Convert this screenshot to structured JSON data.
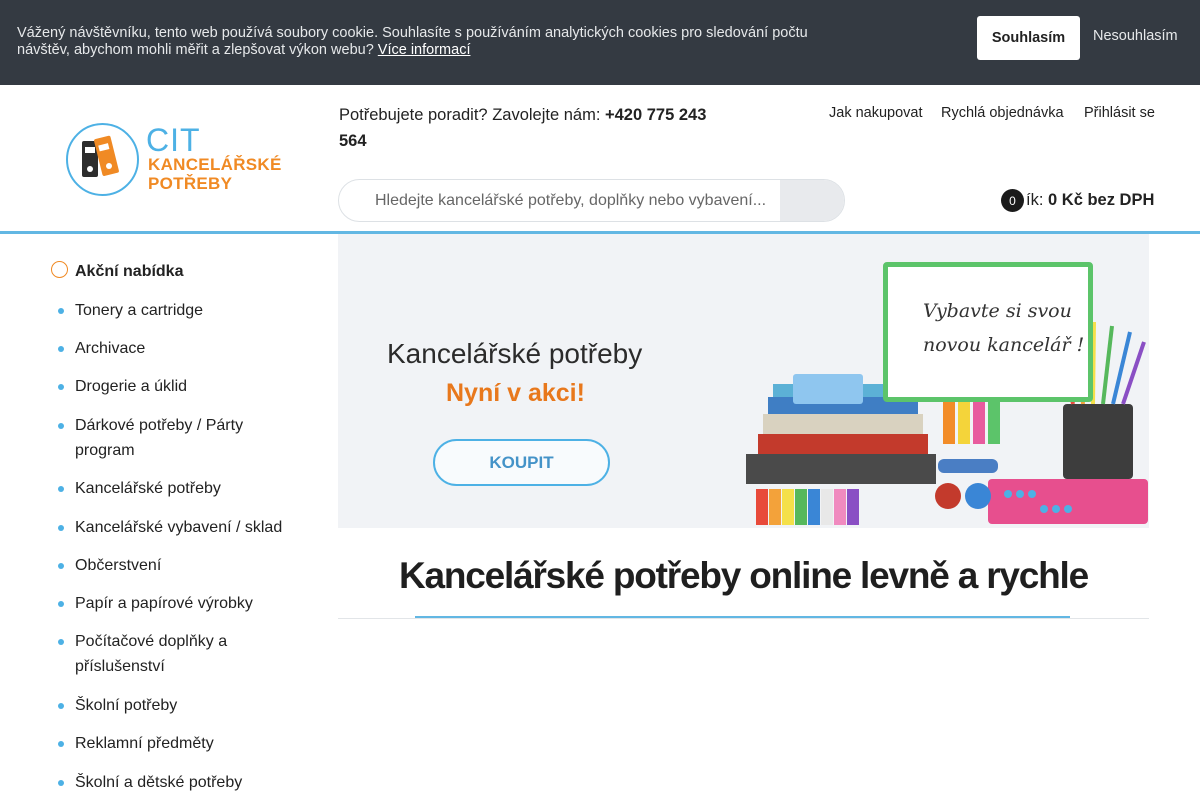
{
  "cookie": {
    "text": "Vážený návštěvníku, tento web používá soubory cookie. Souhlasíte s používáním analytických cookies pro sledování počtu návštěv, abychom mohli měřit a zlepšovat výkon webu?",
    "more_link": "Více informací",
    "accept_label": "Souhlasím",
    "decline_label": "Nesouhlasím"
  },
  "header": {
    "logo": {
      "line1": "CIT",
      "line2": "KANCELÁŘSKÉ",
      "line3": "POTŘEBY"
    },
    "advice_text": "Potřebujete poradit? Zavolejte nám:",
    "phone": "+420 775 243 564",
    "nav": [
      "Jak nakupovat",
      "Rychlá objednávka",
      "Přihlásit se"
    ],
    "search": {
      "placeholder": "Hledejte kancelářské potřeby, doplňky nebo vybavení..."
    },
    "cart": {
      "count": "0",
      "label": "ík:",
      "value": "0 Kč bez DPH"
    }
  },
  "sidebar": {
    "items": [
      {
        "label": "Akční nabídka",
        "active": true
      },
      {
        "label": "Tonery a cartridge"
      },
      {
        "label": "Archivace"
      },
      {
        "label": "Drogerie a úklid"
      },
      {
        "label": "Dárkové potřeby / Párty program"
      },
      {
        "label": "Kancelářské potřeby"
      },
      {
        "label": "Kancelářské vybavení / sklad"
      },
      {
        "label": "Občerstvení"
      },
      {
        "label": "Papír a papírové výrobky"
      },
      {
        "label": "Počítačové doplňky a příslušenství"
      },
      {
        "label": "Školní potřeby"
      },
      {
        "label": "Reklamní předměty"
      },
      {
        "label": "Školní a dětské potřeby"
      }
    ]
  },
  "banner": {
    "title": "Kancelářské potřeby",
    "subtitle": "Nyní v akci!",
    "button_label": "KOUPIT",
    "board_line1": "Vybavte si svou",
    "board_line2": "novou kancelář !"
  },
  "main": {
    "heading": "Kancelářské potřeby online levně a rychle"
  },
  "colors": {
    "accent_blue": "#4db1e5",
    "accent_orange": "#f08a24",
    "cookie_bg": "#343a42"
  }
}
